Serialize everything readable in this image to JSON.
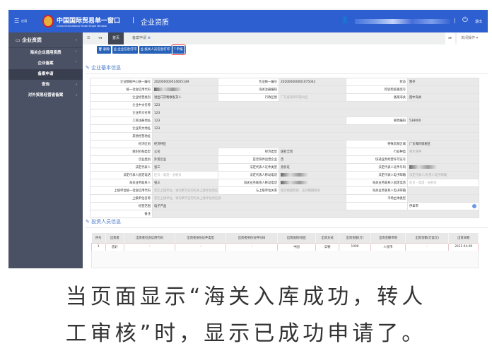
{
  "header": {
    "menu_label": "应用",
    "brand": "中国国际贸易单一窗口",
    "brand_en": "China International Trade Single Window",
    "system": "企业资质",
    "logout": "退出",
    "menu_icon": "hamburger-icon",
    "user_icon": "user-icon",
    "power_icon": "power-icon"
  },
  "sidebar": {
    "title": "企业资质",
    "items": [
      {
        "label": "海关企业通用资质",
        "chevron": "˅"
      },
      {
        "label": "企业备案",
        "chevron": "˅"
      },
      {
        "label": "备案申请",
        "chevron": "",
        "active": true
      },
      {
        "label": "查询",
        "chevron": "‹"
      },
      {
        "label": "对外贸易经营者备案",
        "chevron": "‹"
      }
    ]
  },
  "tabs": {
    "home": "首页",
    "current": "备案申请",
    "close_ops": "关闭操作"
  },
  "toolbar": {
    "delete": "删除",
    "print_company": "企业信息打印",
    "print_persons": "报关人员信息打印",
    "declare": "申报"
  },
  "basic": {
    "title": "企业基本信息",
    "rows": [
      [
        {
          "l": "企业数据中心统一编号",
          "v": "202000000014005149"
        },
        {
          "l": "作业统一编号",
          "v": "202000000001075042"
        },
        {
          "l": "状态",
          "v": "暂存"
        }
      ],
      [
        {
          "l": "统一社会信用代码",
          "v": "",
          "blur": true
        },
        {
          "l": "海关注册编码",
          "v": ""
        },
        {
          "l": "检验检疫备案号",
          "v": ""
        }
      ],
      [
        {
          "l": "企业经营类别",
          "v": "进出口货物收发货人"
        },
        {
          "l": "行政区划",
          "v": "广东省深圳市南山区",
          "ph": true
        },
        {
          "l": "备案海关",
          "v": "韶中海关"
        }
      ],
      [
        {
          "l": "企业中文名称",
          "v": "123",
          "span": 5
        }
      ],
      [
        {
          "l": "企业英文名称",
          "v": "123",
          "span": 5
        }
      ],
      [
        {
          "l": "工商注册地址",
          "v": "123",
          "span": 3
        },
        {
          "l": "邮政编码",
          "v": "538000"
        }
      ],
      [
        {
          "l": "企业英文地址",
          "v": "123",
          "span": 5
        }
      ],
      [
        {
          "l": "其他经营地址",
          "v": "",
          "span": 5
        }
      ],
      [
        {
          "l": "经济区划",
          "v": "经济特区",
          "span": 3
        },
        {
          "l": "特殊贸易区域",
          "v": "广东揭目保税区"
        }
      ],
      [
        {
          "l": "组织机构类型",
          "v": "公司"
        },
        {
          "l": "经济类型",
          "v": "国有全资"
        },
        {
          "l": "行业种类",
          "v": "林木育种",
          "ph": true
        }
      ],
      [
        {
          "l": "企业类别",
          "v": "外贸企业"
        },
        {
          "l": "是否快件运营企业",
          "v": "否"
        },
        {
          "l": "快递业务经营许可证号",
          "v": ""
        }
      ],
      [
        {
          "l": "法定代表人",
          "v": "张三"
        },
        {
          "l": "法定代表人证件类型",
          "v": "身份证"
        },
        {
          "l": "法定代表人证件号码",
          "v": "",
          "blur": true
        }
      ],
      [
        {
          "l": "法定代表人固定电话",
          "v": "区号 -      电话      -  分机号",
          "ph": true,
          "white": true
        },
        {
          "l": "法定代表人移动电话",
          "v": "",
          "blur": true
        },
        {
          "l": "法定代表人电子邮箱",
          "v": "法定代表人/负责人电子邮箱",
          "ph": true
        }
      ],
      [
        {
          "l": "海关业务联系人",
          "v": "张三"
        },
        {
          "l": "海关业务联系人移动电话",
          "v": "",
          "blur": true
        },
        {
          "l": "海关业务联系人固定电话",
          "v": "区号 -      电话      -  分机号",
          "ph": true,
          "white": true
        }
      ],
      [
        {
          "l": "上级单位统一社会信用代码",
          "v": "若无上级单位，请勿填写任何有关上级单位的信息",
          "ph": true
        },
        {
          "l": "与上级单位关系",
          "v": "按空格键检索、支持模糊查询",
          "ph": true
        },
        {
          "l": "海关业务联系人电子邮箱",
          "v": ""
        }
      ],
      [
        {
          "l": "上级单位名称",
          "v": "若无上级单位，请勿填写任何有关上级单位的信息",
          "ph": true,
          "span": 3
        },
        {
          "l": "市场主体类型",
          "v": ""
        }
      ],
      [
        {
          "l": "经营范围",
          "v": "电子产品",
          "span": 3
        },
        {
          "l": "",
          "v": "伊拿带",
          "sel": true,
          "span": 2
        }
      ],
      [
        {
          "l": "备注",
          "v": "",
          "span": 5
        }
      ]
    ]
  },
  "investors": {
    "title": "投资人员信息",
    "columns": [
      "序号",
      "出资者",
      "出资者社会信用代码",
      "出资者身份证件类型",
      "出资者身份证件号码",
      "出资国别\\地区",
      "出资方式",
      "出资金额(万)",
      "出资金额币制",
      "出资金额(万美元)",
      "出资日期"
    ],
    "rows": [
      [
        "1",
        "您好",
        "-",
        "-",
        "-",
        "中国",
        "实物",
        "1000",
        "人民币",
        "-",
        "2021-04-09"
      ]
    ]
  },
  "caption": {
    "line1": "当页面显示“海关入库成功，转人",
    "line2": "工审核”时，显示已成功申请了。"
  },
  "colors": {
    "header": "#2d5fd0",
    "sidebar": "#4b5165",
    "button": "#2762b8",
    "highlight": "#e33333"
  }
}
